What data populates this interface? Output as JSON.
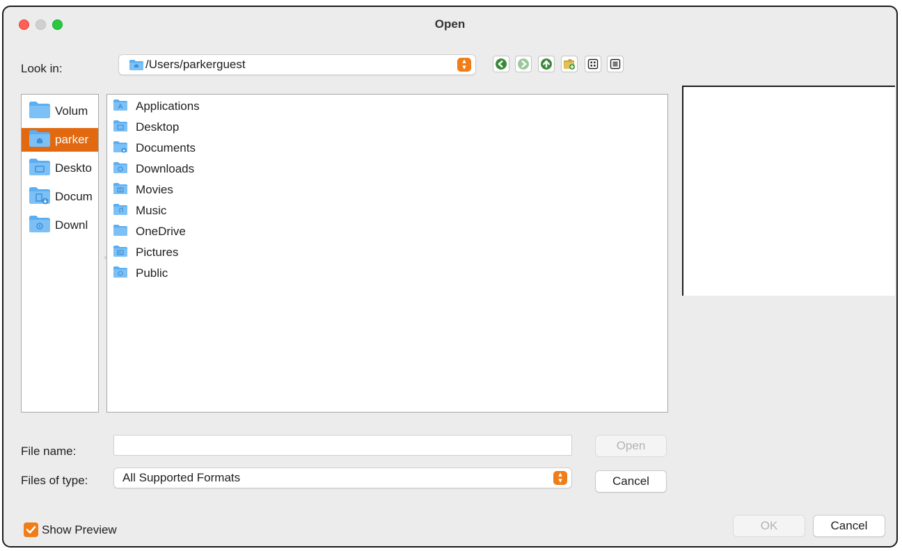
{
  "window": {
    "title": "Open"
  },
  "look_in": {
    "label": "Look in:",
    "path": "/Users/parkerguest"
  },
  "toolbar": {
    "back_icon": "back-arrow-icon",
    "forward_icon": "forward-arrow-icon",
    "up_icon": "parent-directory-icon",
    "new_folder_icon": "new-folder-icon",
    "list_view_icon": "list-view-icon",
    "detail_view_icon": "detail-view-icon"
  },
  "sidebar": {
    "items": [
      {
        "label": "Volum",
        "selected": false
      },
      {
        "label": "parker",
        "selected": true
      },
      {
        "label": "Deskto",
        "selected": false
      },
      {
        "label": "Docum",
        "selected": false
      },
      {
        "label": "Downl",
        "selected": false
      }
    ]
  },
  "files": {
    "items": [
      "Applications",
      "Desktop",
      "Documents",
      "Downloads",
      "Movies",
      "Music",
      "OneDrive",
      "Pictures",
      "Public"
    ]
  },
  "file_name": {
    "label": "File name:",
    "value": "",
    "open_button": "Open"
  },
  "file_type": {
    "label": "Files of type:",
    "value": "All Supported Formats",
    "cancel_button": "Cancel"
  },
  "show_preview": {
    "label": "Show Preview",
    "checked": true
  },
  "footer": {
    "ok_button": "OK",
    "cancel_button": "Cancel"
  },
  "colors": {
    "accent": "#f07d17",
    "selection": "#e2690f",
    "folder": "#5aaef2"
  }
}
